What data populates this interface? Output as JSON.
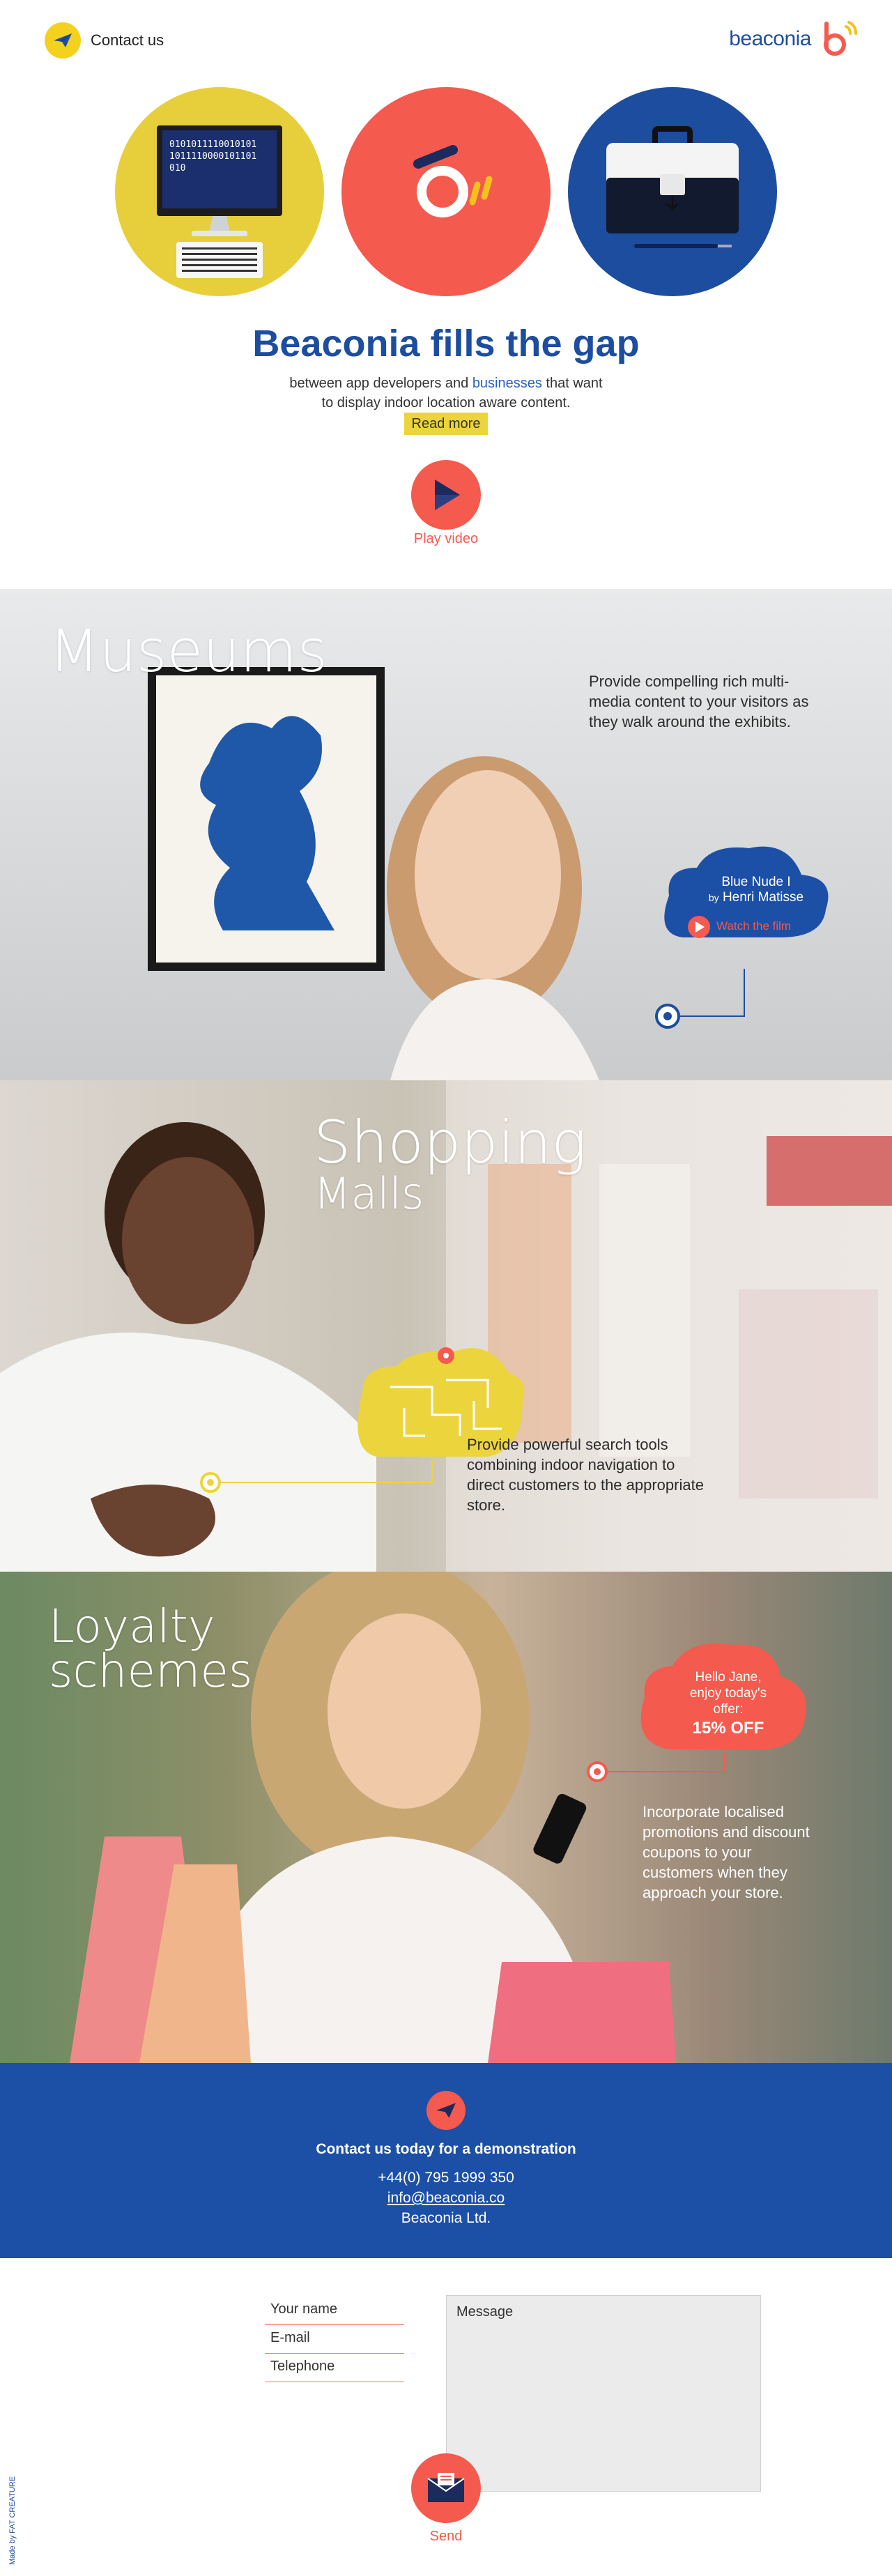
{
  "header": {
    "contact_label": "Contact us",
    "logo_text": "beaconia"
  },
  "hero": {
    "binary_lines": [
      "0101011110010101",
      "1011110000101101",
      "010"
    ],
    "title": "Beaconia fills the gap",
    "subtitle_pre": "between app developers and ",
    "subtitle_link": "businesses",
    "subtitle_post": " that want",
    "subtitle_line2": "to display indoor location aware content.",
    "read_more": "Read more",
    "play_label": "Play video"
  },
  "museums": {
    "title": "Museums",
    "description": "Provide compelling rich multi-media content to your visitors as they walk around the exhibits.",
    "cloud_title": "Blue Nude I",
    "cloud_by": "by",
    "cloud_artist": "Henri Matisse",
    "cloud_link": "Watch the film"
  },
  "malls": {
    "title_line1": "Shopping",
    "title_line2": "Malls",
    "description": "Provide powerful search tools combining indoor navigation to direct customers to the appropriate store."
  },
  "loyalty": {
    "title_line1": "Loyalty",
    "title_line2": "schemes",
    "cloud_line1": "Hello Jane,",
    "cloud_line2": "enjoy today's",
    "cloud_line3": "offer:",
    "cloud_offer": "15% OFF",
    "description": "Incorporate localised promotions and discount coupons to your customers when they approach your store."
  },
  "contact_band": {
    "title": "Contact us today for a demonstration",
    "phone": "+44(0) 795 1999 350",
    "email": "info@beaconia.co",
    "company": "Beaconia Ltd."
  },
  "form": {
    "name_label": "Your name",
    "email_label": "E-mail",
    "phone_label": "Telephone",
    "message_label": "Message",
    "send_label": "Send"
  },
  "footer": {
    "made_by": "Made by FAT CREATURE"
  },
  "colors": {
    "brand_blue": "#1c4d9f",
    "coral": "#f55a4e",
    "yellow": "#ecd43d"
  }
}
